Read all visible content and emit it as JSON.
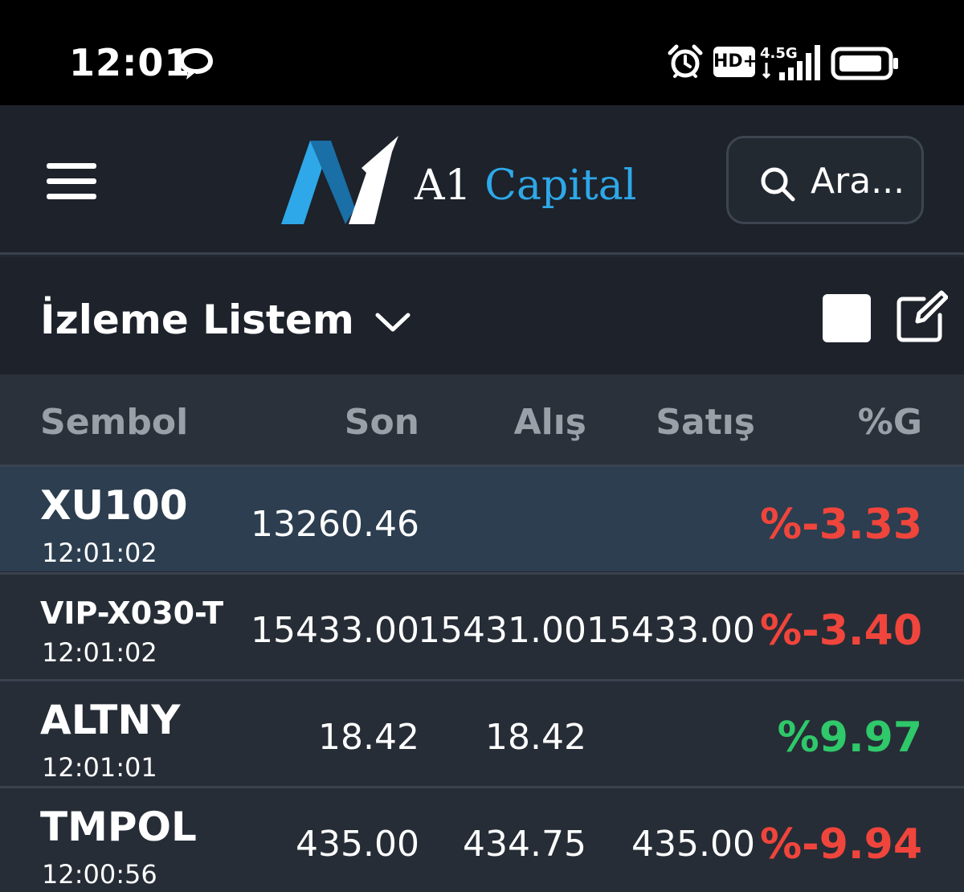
{
  "status_bar": {
    "time": "12:01",
    "hd_label": "HD+",
    "network_label": "4.5G",
    "icons": [
      "chat-bubble-icon",
      "alarm-icon",
      "signal-icon",
      "battery-icon"
    ]
  },
  "header": {
    "logo_a1": "A1",
    "logo_capital": "Capital",
    "search_label": "Ara...",
    "icons": [
      "hamburger-menu-icon",
      "search-icon"
    ],
    "colors": {
      "brand_blue": "#2ea8e8",
      "background": "#1d222b"
    }
  },
  "watchlist": {
    "title": "İzleme Listem",
    "icons": [
      "chevron-down-icon",
      "square-icon",
      "edit-icon"
    ]
  },
  "table": {
    "columns": [
      "Sembol",
      "Son",
      "Alış",
      "Satış",
      "%G"
    ],
    "rows": [
      {
        "symbol": "XU100",
        "time": "12:01:02",
        "son": "13260.46",
        "alis": "",
        "satis": "",
        "change": "%-3.33",
        "trend": "negative"
      },
      {
        "symbol": "VIP-X030-T",
        "time": "12:01:02",
        "son": "15433.00",
        "alis": "15431.00",
        "satis": "15433.00",
        "change": "%-3.40",
        "trend": "negative"
      },
      {
        "symbol": "ALTNY",
        "time": "12:01:01",
        "son": "18.42",
        "alis": "18.42",
        "satis": "",
        "change": "%9.97",
        "trend": "positive"
      },
      {
        "symbol": "TMPOL",
        "time": "12:00:56",
        "son": "435.00",
        "alis": "434.75",
        "satis": "435.00",
        "change": "%-9.94",
        "trend": "negative"
      }
    ],
    "colors": {
      "negative": "#f0453c",
      "positive": "#2fc86a"
    }
  }
}
